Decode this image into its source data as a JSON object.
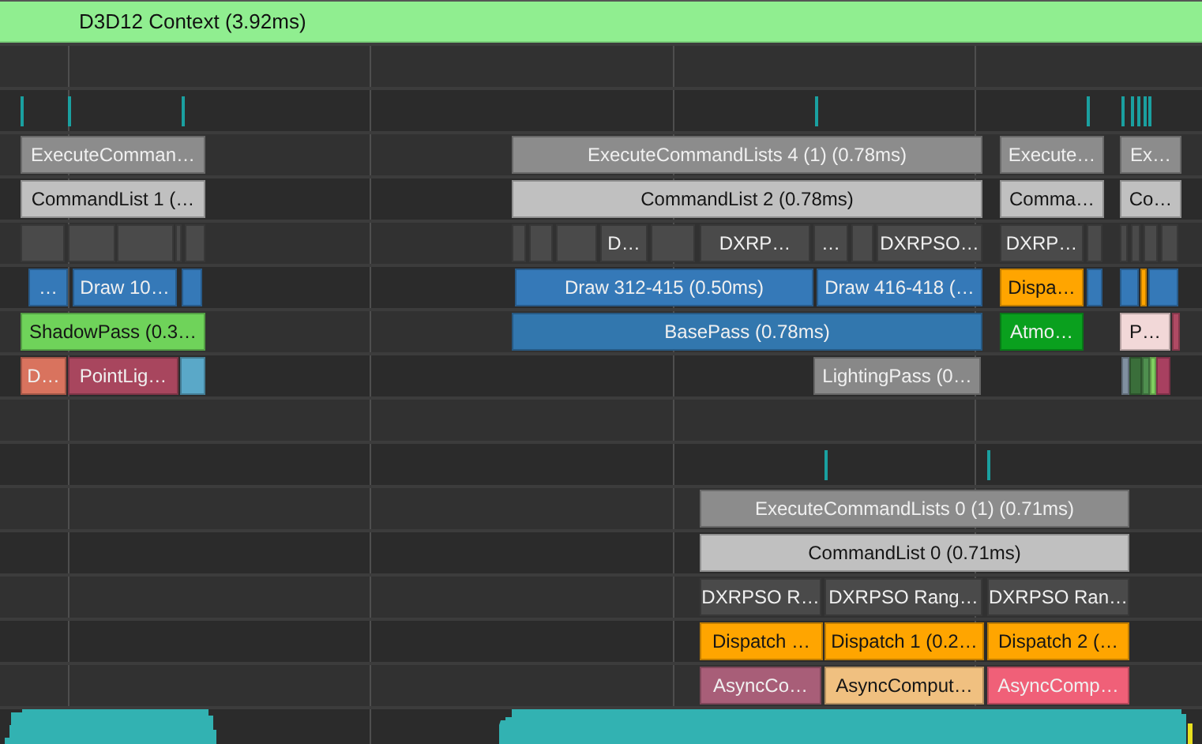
{
  "header": {
    "label": "D3D12 Context (3.92ms)"
  },
  "tracks": [
    {
      "blocks": [
        {
          "label": "ExecuteComman…",
          "color": "#8c8c8c"
        },
        {
          "label": "ExecuteCommandLists 4 (1) (0.78ms)",
          "color": "#8c8c8c"
        },
        {
          "label": "Execute…",
          "color": "#8c8c8c"
        },
        {
          "label": "Ex…",
          "color": "#8c8c8c"
        }
      ]
    },
    {
      "blocks": [
        {
          "label": "CommandList 1 (…",
          "color": "#c0c0c0"
        },
        {
          "label": "CommandList 2 (0.78ms)",
          "color": "#c0c0c0"
        },
        {
          "label": "Comma…",
          "color": "#c0c0c0"
        },
        {
          "label": "Co…",
          "color": "#c0c0c0"
        }
      ]
    },
    {
      "blocks": [
        {
          "color": "#4a4a4a"
        },
        {
          "color": "#4a4a4a"
        },
        {
          "color": "#4a4a4a"
        },
        {
          "color": "#4a4a4a"
        },
        {
          "color": "#4a4a4a"
        },
        {
          "color": "#4a4a4a"
        },
        {
          "color": "#4a4a4a"
        },
        {
          "color": "#4a4a4a"
        },
        {
          "label": "D…",
          "color": "#4a4a4a"
        },
        {
          "color": "#4a4a4a"
        },
        {
          "label": "DXRP…",
          "color": "#4a4a4a"
        },
        {
          "label": "…",
          "color": "#4a4a4a"
        },
        {
          "color": "#4a4a4a"
        },
        {
          "label": "DXRPSO…",
          "color": "#4a4a4a"
        },
        {
          "label": "DXRP…",
          "color": "#4a4a4a"
        },
        {
          "color": "#4a4a4a"
        },
        {
          "color": "#4a4a4a"
        },
        {
          "color": "#4a4a4a"
        },
        {
          "color": "#4a4a4a"
        },
        {
          "color": "#4a4a4a"
        }
      ]
    },
    {
      "blocks": [
        {
          "label": "…",
          "color": "#3579b8"
        },
        {
          "label": "Draw 10…",
          "color": "#3579b8"
        },
        {
          "color": "#3579b8"
        },
        {
          "label": "Draw 312-415 (0.50ms)",
          "color": "#3579b8"
        },
        {
          "label": "Draw 416-418 (…",
          "color": "#3579b8"
        },
        {
          "label": "Dispa…",
          "color": "#ffa500"
        },
        {
          "color": "#3579b8"
        },
        {
          "color": "#3579b8"
        },
        {
          "color": "#ffa500"
        },
        {
          "color": "#3579b8"
        }
      ]
    },
    {
      "blocks": [
        {
          "label": "ShadowPass (0.3…",
          "color": "#6fd35a"
        },
        {
          "label": "BasePass (0.78ms)",
          "color": "#3277ae"
        },
        {
          "label": "Atmo…",
          "color": "#0aa01e"
        },
        {
          "label": "P…",
          "color": "#f2d8d8"
        },
        {
          "color": "#b04a64"
        }
      ]
    },
    {
      "blocks": [
        {
          "label": "D…",
          "color": "#d9735e"
        },
        {
          "label": "PointLig…",
          "color": "#a8465e"
        },
        {
          "color": "#5aa8c8"
        },
        {
          "label": "LightingPass (0…",
          "color": "#888888"
        },
        {
          "color": "#8090a0"
        },
        {
          "color": "#3a6e3a"
        },
        {
          "color": "#4f8f4f"
        },
        {
          "color": "#80d060"
        },
        {
          "color": "#a84060"
        }
      ]
    },
    {
      "blocks": [
        {
          "label": "ExecuteCommandLists 0 (1) (0.71ms)",
          "color": "#8c8c8c"
        }
      ]
    },
    {
      "blocks": [
        {
          "label": "CommandList 0 (0.71ms)",
          "color": "#c0c0c0"
        }
      ]
    },
    {
      "blocks": [
        {
          "label": "DXRPSO R…",
          "color": "#4a4a4a"
        },
        {
          "label": "DXRPSO Rang…",
          "color": "#4a4a4a"
        },
        {
          "label": "DXRPSO Ran…",
          "color": "#4a4a4a"
        }
      ]
    },
    {
      "blocks": [
        {
          "label": "Dispatch …",
          "color": "#ffa500"
        },
        {
          "label": "Dispatch 1 (0.2…",
          "color": "#ffa500"
        },
        {
          "label": "Dispatch 2 (…",
          "color": "#ffa500"
        }
      ]
    },
    {
      "blocks": [
        {
          "label": "AsyncCo…",
          "color": "#a85e78"
        },
        {
          "label": "AsyncComput…",
          "color": "#f0c080"
        },
        {
          "label": "AsyncComp…",
          "color": "#f06078"
        }
      ]
    }
  ]
}
